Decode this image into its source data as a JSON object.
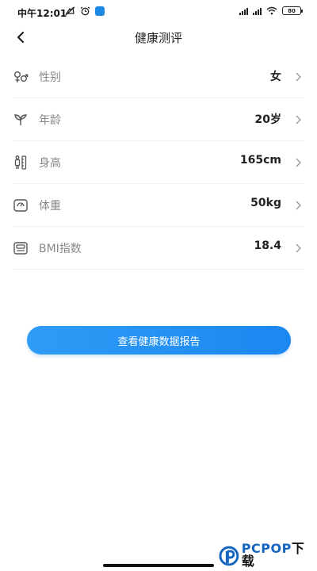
{
  "status_bar": {
    "time": "中午12:01",
    "battery": "80"
  },
  "header": {
    "title": "健康测评"
  },
  "items": [
    {
      "label": "性别",
      "value": "女",
      "icon": "gender-icon"
    },
    {
      "label": "年龄",
      "value": "20岁",
      "icon": "sprout-icon"
    },
    {
      "label": "身高",
      "value": "165cm",
      "icon": "height-icon"
    },
    {
      "label": "体重",
      "value": "50kg",
      "icon": "scale-icon"
    },
    {
      "label": "BMI指数",
      "value": "18.4",
      "icon": "bmi-icon"
    }
  ],
  "actions": {
    "report_label": "查看健康数据报告"
  },
  "watermark": {
    "brand": "PCPOP",
    "brand_suffix": "下载"
  },
  "colors": {
    "accent": "#1b87f0",
    "label_gray": "#888888",
    "divider": "#f0f0f0"
  }
}
